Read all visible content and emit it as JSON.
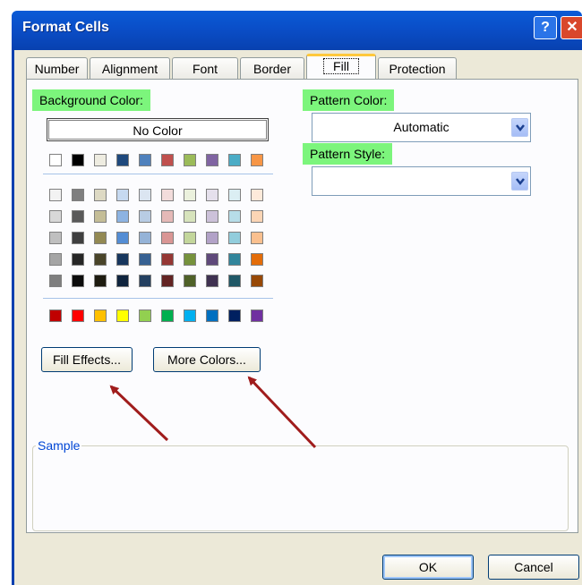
{
  "window": {
    "title": "Format Cells",
    "help_label": "?",
    "close_label": "✕"
  },
  "tabs": [
    {
      "label": "Number"
    },
    {
      "label": "Alignment"
    },
    {
      "label": "Font"
    },
    {
      "label": "Border"
    },
    {
      "label": "Fill",
      "active": true
    },
    {
      "label": "Protection"
    }
  ],
  "background": {
    "label": "Background Color:",
    "no_color_label": "No Color",
    "theme_row": [
      "#ffffff",
      "#000000",
      "#eeece1",
      "#1f497d",
      "#4f81bd",
      "#c0504d",
      "#9bbb59",
      "#8064a2",
      "#4bacc6",
      "#f79646"
    ],
    "tint_rows": [
      [
        "#f2f2f2",
        "#7f7f7f",
        "#ddd9c3",
        "#c6d9f0",
        "#dbe5f1",
        "#f2dcdb",
        "#ebf1dd",
        "#e5e0ec",
        "#dbeef3",
        "#fdeada"
      ],
      [
        "#d8d8d8",
        "#595959",
        "#c4bd97",
        "#8db3e2",
        "#b8cce4",
        "#e5b9b7",
        "#d7e3bc",
        "#ccc1d9",
        "#b7dde8",
        "#fbd5b5"
      ],
      [
        "#bfbfbf",
        "#3f3f3f",
        "#938953",
        "#548dd4",
        "#95b3d7",
        "#d99694",
        "#c3d69b",
        "#b2a2c7",
        "#92cddc",
        "#fac08f"
      ],
      [
        "#a5a5a5",
        "#262626",
        "#494429",
        "#17365d",
        "#366092",
        "#953734",
        "#76923c",
        "#5f497a",
        "#31859b",
        "#e36c09"
      ],
      [
        "#7f7f7f",
        "#0c0c0c",
        "#1d1b10",
        "#0f243e",
        "#244061",
        "#632423",
        "#4f6128",
        "#3f3151",
        "#205867",
        "#974806"
      ]
    ],
    "standard_row": [
      "#c00000",
      "#ff0000",
      "#ffc000",
      "#ffff00",
      "#92d050",
      "#00b050",
      "#00b0f0",
      "#0070c0",
      "#002060",
      "#7030a0"
    ]
  },
  "pattern": {
    "color_label": "Pattern Color:",
    "color_value": "Automatic",
    "style_label": "Pattern Style:",
    "style_value": ""
  },
  "buttons": {
    "fill_effects": "Fill Effects...",
    "more_colors": "More Colors...",
    "ok": "OK",
    "cancel": "Cancel"
  },
  "sample": {
    "label": "Sample"
  },
  "colors": {
    "highlight": "#7cf57c",
    "arrow": "#a01c1c",
    "title_bar": "#0a4ec8"
  }
}
